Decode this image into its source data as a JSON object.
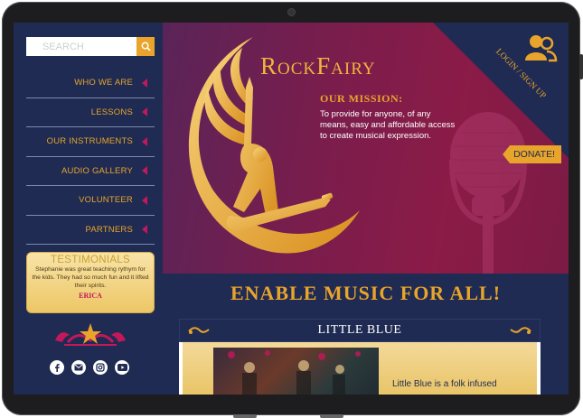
{
  "sidebar": {
    "search_placeholder": "SEARCH",
    "nav": [
      {
        "label": "WHO WE ARE"
      },
      {
        "label": "LESSONS"
      },
      {
        "label": "OUR INSTRUMENTS"
      },
      {
        "label": "AUDIO GALLERY"
      },
      {
        "label": "VOLUNTEER"
      },
      {
        "label": "PARTNERS"
      }
    ],
    "testimonial": {
      "title": "TESTIMONIALS",
      "quote": "Stephanie was great teaching rythym for the kids. They had so much fun and it lifted their spirits.",
      "author": "ERICA"
    },
    "socials": [
      "facebook-icon",
      "email-icon",
      "instagram-icon",
      "youtube-icon"
    ]
  },
  "hero": {
    "brand": "RockFairy",
    "mission_title": "OUR MISSION:",
    "mission_text": "To provide for anyone, of any means, easy and affordable access to create musical expression.",
    "login": "LOGIN / SIGN UP",
    "donate": "DONATE!"
  },
  "banner": {
    "text": "ENABLE MUSIC FOR ALL!"
  },
  "card": {
    "title": "LITTLE BLUE",
    "text": "Little Blue is a folk infused"
  },
  "colors": {
    "navy": "#1f2b52",
    "gold": "#e8a42b",
    "magenta": "#c3185a",
    "plum": "#7a1d4c"
  }
}
